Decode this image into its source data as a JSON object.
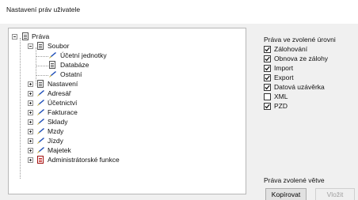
{
  "window": {
    "title": "Nastavení práv uživatele"
  },
  "tree": {
    "root": "Práva",
    "soubor": "Soubor",
    "soubor_children": [
      "Účetní jednotky",
      "Databáze",
      "Ostatní"
    ],
    "items": [
      "Nastavení",
      "Adresář",
      "Účetnictví",
      "Fakturace",
      "Sklady",
      "Mzdy",
      "Jízdy",
      "Majetek",
      "Administrátorské funkce"
    ]
  },
  "rights": {
    "heading": "Práva ve zvolené úrovni",
    "options": [
      {
        "label": "Zálohování",
        "checked": true
      },
      {
        "label": "Obnova ze zálohy",
        "checked": true
      },
      {
        "label": "Import",
        "checked": true
      },
      {
        "label": "Export",
        "checked": true
      },
      {
        "label": "Datová uzávěrka",
        "checked": true
      },
      {
        "label": "XML",
        "checked": false
      },
      {
        "label": "PZD",
        "checked": true
      }
    ]
  },
  "branch": {
    "heading": "Práva zvolené větve",
    "copy_label": "Kopírovat",
    "paste_label": "Vložit"
  },
  "icon_colors": {
    "pen_blue": "#1f4fb8",
    "pen_yellow": "#e8c21c",
    "doc_red": "#c01010"
  }
}
